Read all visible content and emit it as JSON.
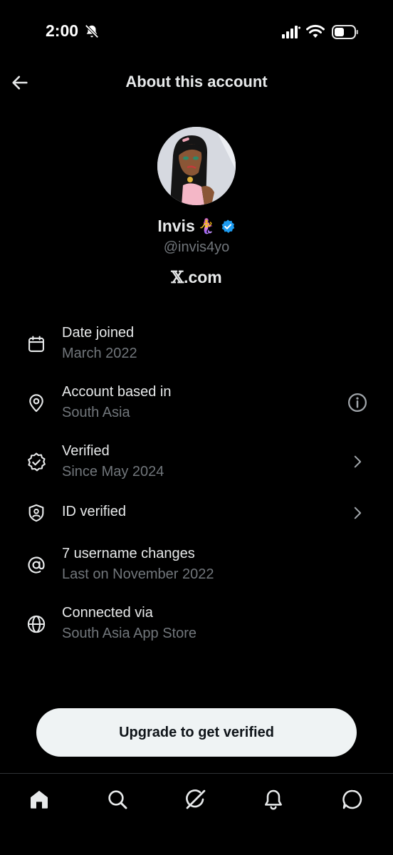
{
  "status_bar": {
    "time": "2:00"
  },
  "header": {
    "title": "About this account",
    "back_icon": "arrow-left-icon"
  },
  "profile": {
    "display_name": "Invis",
    "name_emoji": "🧜‍♀️",
    "handle": "@invis4yo",
    "site_prefix": "𝕏",
    "site_suffix": ".com",
    "verified_color": "#1d9bf0"
  },
  "info": [
    {
      "icon": "calendar-icon",
      "label": "Date joined",
      "value": "March 2022",
      "trailing": ""
    },
    {
      "icon": "location-pin-icon",
      "label": "Account based in",
      "value": "South Asia",
      "trailing": "info-icon"
    },
    {
      "icon": "verified-badge-outline-icon",
      "label": "Verified",
      "value": "Since May 2024",
      "trailing": "chevron-right-icon"
    },
    {
      "icon": "id-shield-icon",
      "label": "ID verified",
      "value": "",
      "trailing": "chevron-right-icon"
    },
    {
      "icon": "at-sign-icon",
      "label": "7 username changes",
      "value": "Last on November 2022",
      "trailing": ""
    },
    {
      "icon": "globe-icon",
      "label": "Connected via",
      "value": "South Asia App Store",
      "trailing": ""
    }
  ],
  "upgrade_button": {
    "label": "Upgrade to get verified"
  },
  "bottom_nav": [
    {
      "icon": "home-icon"
    },
    {
      "icon": "search-icon"
    },
    {
      "icon": "grok-icon"
    },
    {
      "icon": "bell-icon"
    },
    {
      "icon": "chat-icon"
    }
  ],
  "colors": {
    "background": "#000000",
    "primary_text": "#e7e9ea",
    "secondary_text": "#71767b",
    "button_bg": "#eff3f4",
    "button_text": "#0f1419"
  }
}
